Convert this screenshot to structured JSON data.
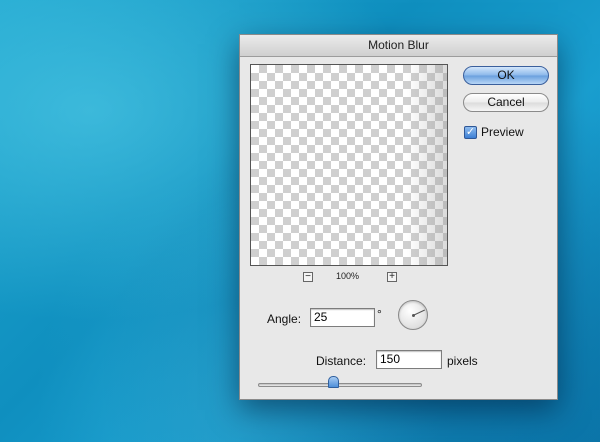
{
  "dialog": {
    "title": "Motion Blur",
    "zoom": {
      "minus_label": "−",
      "plus_label": "+",
      "level": "100%"
    },
    "buttons": {
      "ok_label": "OK",
      "cancel_label": "Cancel"
    },
    "preview_checkbox": {
      "label": "Preview",
      "checked": true,
      "mark": "✓"
    },
    "angle": {
      "label": "Angle:",
      "value": "25",
      "unit": "°"
    },
    "distance": {
      "label": "Distance:",
      "value": "150",
      "unit": "pixels"
    },
    "slider": {
      "value": 150,
      "min": 1,
      "max": 999,
      "fill_fraction": 0.46
    }
  },
  "icons": {
    "angle_dial": "angle-dial-icon",
    "checkbox_mark": "checkmark-icon"
  },
  "colors": {
    "ok_button": "#8db9ea",
    "checkbox": "#3c7fd4",
    "background": "#1599c8"
  }
}
